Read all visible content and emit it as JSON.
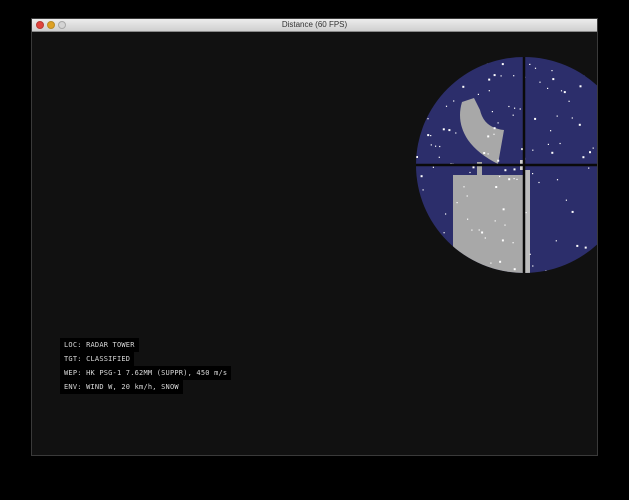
{
  "window": {
    "title": "Distance (60 FPS)"
  },
  "hud": {
    "lines": [
      "LOC: RADAR TOWER",
      "TGT: CLASSIFIED",
      "WEP: HK PSG-1 7.62MM (SUPPR), 450 m/s",
      "ENV: WIND W, 20 km/h, SNOW"
    ]
  },
  "icons": {
    "close": "close-icon",
    "minimize": "minimize-icon",
    "maximize": "maximize-icon"
  },
  "colors": {
    "scope_sky": "#2c2e6b",
    "structure": "#a8a8a8",
    "crosshair": "#0a0a0a",
    "snow": "#ffffff",
    "hud_text": "#d8d8d8",
    "hud_bg": "#000000",
    "close": "#e0443e",
    "minimize": "#dea123",
    "maximize": "#d4d4d4"
  }
}
